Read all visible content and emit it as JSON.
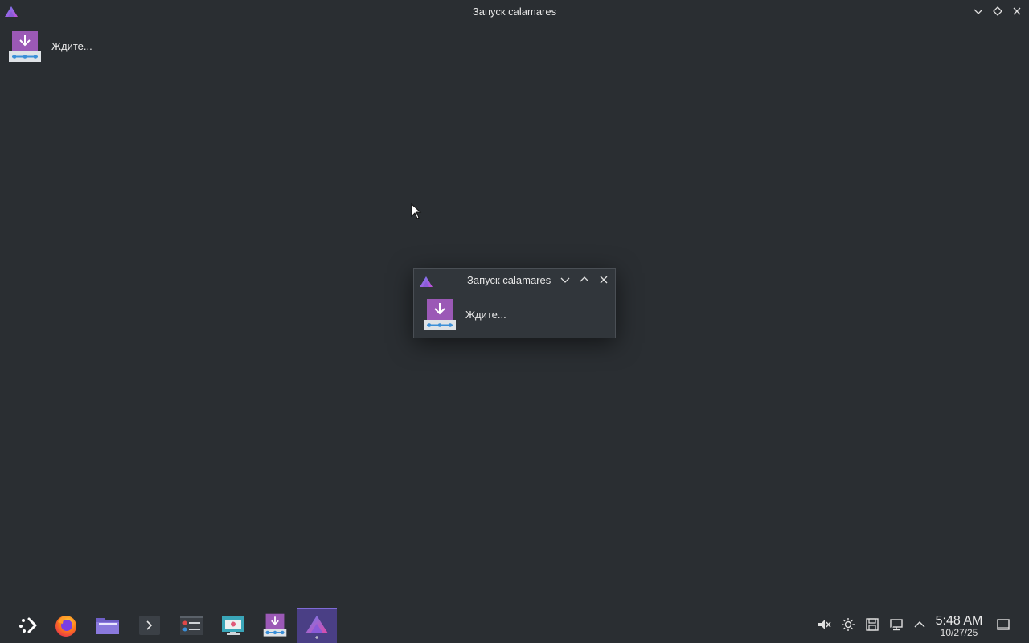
{
  "window": {
    "title": "Запуск calamares",
    "status_text": "Ждите..."
  },
  "dialog": {
    "title": "Запуск calamares",
    "status_text": "Ждите..."
  },
  "taskbar": {
    "items": [
      {
        "name": "app-launcher",
        "icon": "kde-launcher-icon"
      },
      {
        "name": "firefox",
        "icon": "firefox-icon"
      },
      {
        "name": "file-manager",
        "icon": "folder-icon"
      },
      {
        "name": "terminal",
        "icon": "terminal-icon"
      },
      {
        "name": "system-monitor",
        "icon": "dashboard-icon"
      },
      {
        "name": "screenshot-tool",
        "icon": "screenshot-icon"
      },
      {
        "name": "installer",
        "icon": "installer-icon"
      },
      {
        "name": "calamares",
        "icon": "calamares-icon",
        "active": true
      }
    ],
    "tray": {
      "icons": [
        "muted-speaker-icon",
        "brightness-icon",
        "save-icon",
        "network-icon",
        "chevron-up-icon"
      ],
      "time": "5:48 AM",
      "date": "10/27/25"
    }
  },
  "colors": {
    "background": "#2a2e32",
    "dialog_bg": "#31363b",
    "accent_purple": "#9b59b6",
    "active_task": "#4a3f85"
  }
}
